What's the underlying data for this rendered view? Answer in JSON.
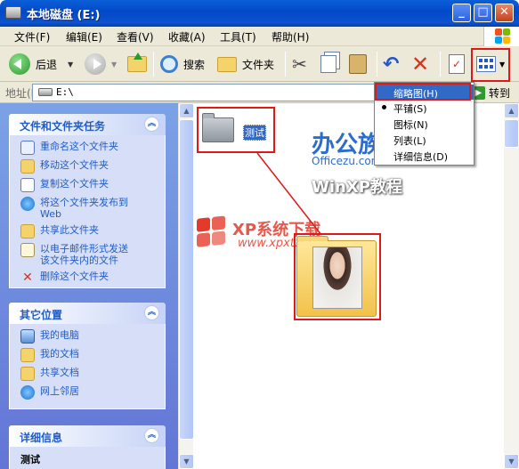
{
  "window": {
    "title": "本地磁盘 (E:)",
    "controls": [
      "minimize",
      "maximize",
      "close"
    ]
  },
  "menubar": {
    "items": [
      "文件(F)",
      "编辑(E)",
      "查看(V)",
      "收藏(A)",
      "工具(T)",
      "帮助(H)"
    ]
  },
  "toolbar": {
    "back_label": "后退",
    "search_label": "搜索",
    "folders_label": "文件夹"
  },
  "address": {
    "label": "地址(D)",
    "value": "E:\\",
    "go_label": "转到"
  },
  "view_menu": {
    "items": [
      "缩略图(H)",
      "平铺(S)",
      "图标(N)",
      "列表(L)",
      "详细信息(D)"
    ],
    "selected": "缩略图(H)",
    "checked": "平铺(S)"
  },
  "tasks_panel": {
    "title": "文件和文件夹任务",
    "items": [
      {
        "label": "重命名这个文件夹",
        "icon": "rename-icon"
      },
      {
        "label": "移动这个文件夹",
        "icon": "move-icon"
      },
      {
        "label": "复制这个文件夹",
        "icon": "copy-icon"
      },
      {
        "label": "将这个文件夹发布到\nWeb",
        "icon": "publish-web-icon"
      },
      {
        "label": "共享此文件夹",
        "icon": "share-icon"
      },
      {
        "label": "以电子邮件形式发送\n该文件夹内的文件",
        "icon": "email-icon"
      },
      {
        "label": "删除这个文件夹",
        "icon": "delete-icon"
      }
    ]
  },
  "places_panel": {
    "title": "其它位置",
    "items": [
      {
        "label": "我的电脑",
        "icon": "my-computer-icon"
      },
      {
        "label": "我的文档",
        "icon": "my-documents-icon"
      },
      {
        "label": "共享文档",
        "icon": "shared-documents-icon"
      },
      {
        "label": "网上邻居",
        "icon": "network-icon"
      }
    ]
  },
  "details_panel": {
    "title": "详细信息",
    "name": "测试"
  },
  "content": {
    "folder_name": "测试"
  },
  "watermarks": {
    "brand_cn": "办公族",
    "brand_url": "Officezu.com",
    "brand_sub": "WinXP教程",
    "xp_title": "XP系统下载",
    "xp_url": "www.xpxt.net"
  },
  "colors": {
    "title_bar": "#0a5fd8",
    "task_pane": "#7ba2e7",
    "link": "#215dc6",
    "highlight": "#316ac5",
    "annotation": "#e01818"
  }
}
